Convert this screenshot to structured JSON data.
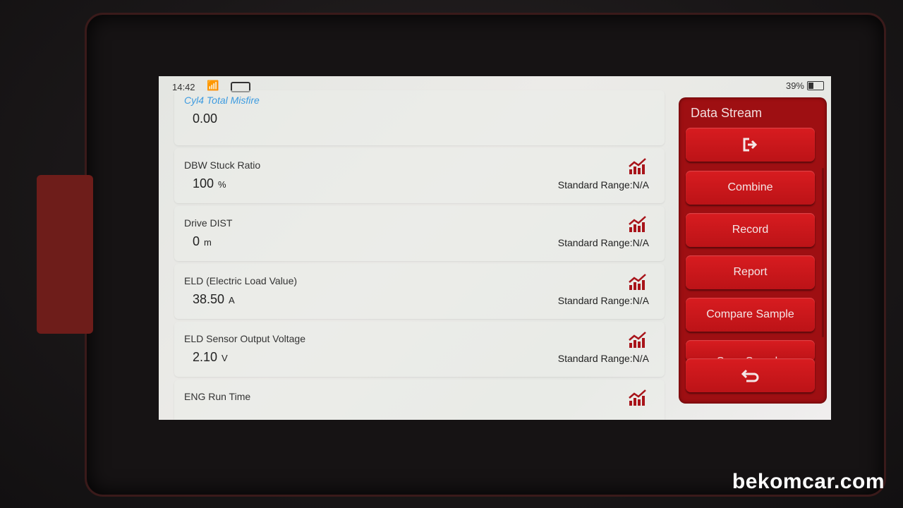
{
  "status_bar": {
    "time": "14:42",
    "wifi_icon": "wifi-icon",
    "vci_icon": "vci-connector-icon",
    "battery_percent": "39%",
    "battery_level": 0.39
  },
  "rows": [
    {
      "label": "Cyl4 Total Misfire",
      "value": "0.00",
      "unit": "",
      "range": ""
    },
    {
      "label": "DBW Stuck Ratio",
      "value": "100",
      "unit": "%",
      "range": "Standard Range:N/A"
    },
    {
      "label": "Drive DIST",
      "value": "0",
      "unit": "m",
      "range": "Standard Range:N/A"
    },
    {
      "label": "ELD (Electric Load Value)",
      "value": "38.50",
      "unit": "A",
      "range": "Standard Range:N/A"
    },
    {
      "label": "ELD Sensor Output Voltage",
      "value": "2.10",
      "unit": "V",
      "range": "Standard Range:N/A"
    },
    {
      "label": "ENG Run Time",
      "value": "",
      "unit": "",
      "range": ""
    }
  ],
  "panel": {
    "title": "Data Stream",
    "buttons": [
      "Combine",
      "Record",
      "Report",
      "Compare Sample",
      "Save Sample"
    ],
    "exit_icon": "exit-icon",
    "back_icon": "back-icon"
  },
  "colors": {
    "accent": "#c4161a",
    "panel": "#9e0f12",
    "highlight_label": "#3d9be0"
  },
  "watermark": "bekomcar.com"
}
